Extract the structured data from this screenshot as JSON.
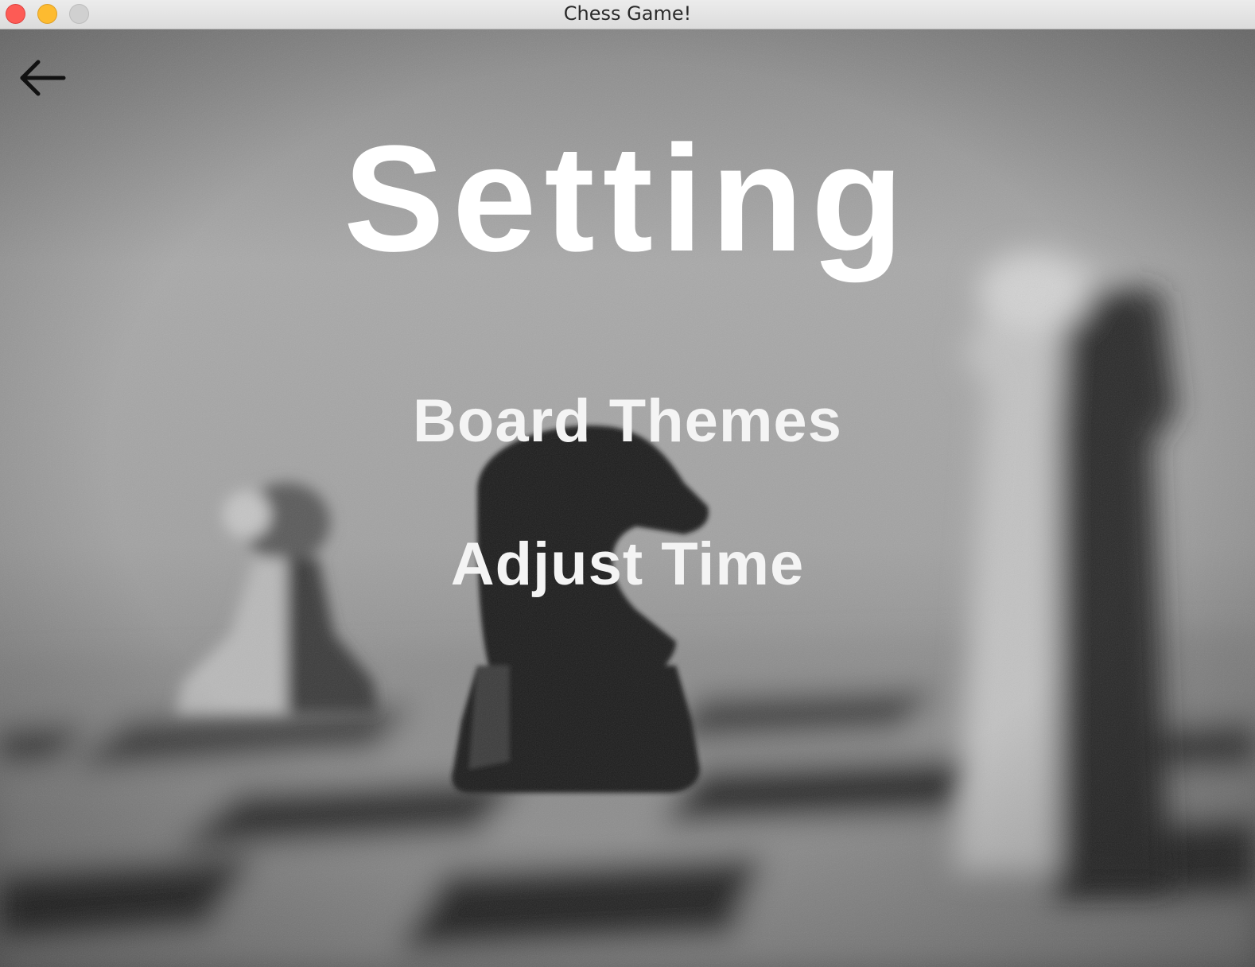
{
  "window": {
    "title": "Chess Game!"
  },
  "nav": {
    "back_icon": "arrow-left-icon"
  },
  "page": {
    "heading": "Setting"
  },
  "menu": {
    "items": [
      {
        "label": "Board Themes"
      },
      {
        "label": "Adjust Time"
      }
    ]
  },
  "colors": {
    "heading_text": "#ffffff",
    "menu_text": "#f4f4f4",
    "close_button": "#fd5b55",
    "minimize_button": "#fdbb30",
    "zoom_button": "#d0d0d0"
  }
}
